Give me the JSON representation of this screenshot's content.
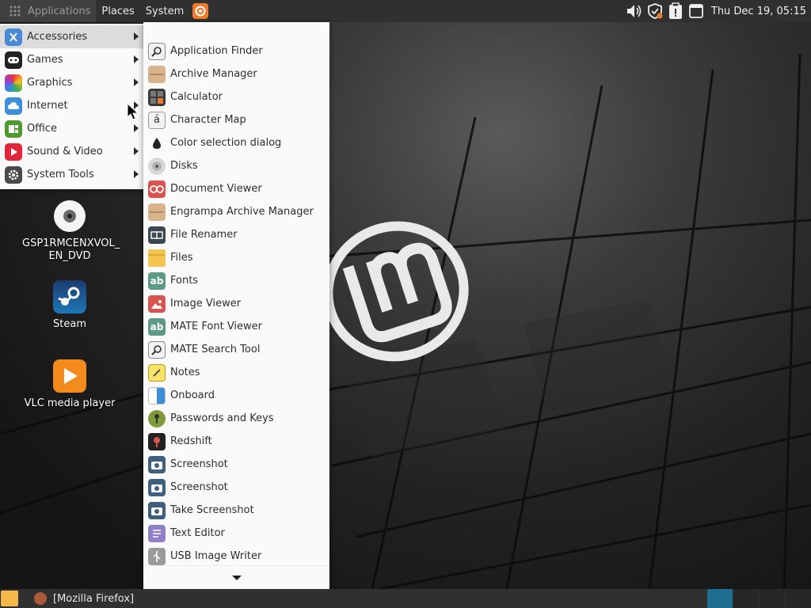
{
  "top_panel": {
    "menus": [
      "Applications",
      "Places",
      "System"
    ],
    "clock": "Thu Dec 19, 05:15",
    "tray_icons": [
      "volume-icon",
      "shield-update-icon",
      "clipboard-icon",
      "window-list-icon"
    ]
  },
  "categories": [
    {
      "label": "Accessories",
      "icon": "scissors-icon",
      "color": "#4a8ad4",
      "selected": true
    },
    {
      "label": "Games",
      "icon": "gamepad-icon",
      "color": "#222222"
    },
    {
      "label": "Graphics",
      "icon": "palette-icon",
      "color": "#d64bb0"
    },
    {
      "label": "Internet",
      "icon": "cloud-icon",
      "color": "#3c8fd8"
    },
    {
      "label": "Office",
      "icon": "office-icon",
      "color": "#4e9a2f"
    },
    {
      "label": "Sound & Video",
      "icon": "play-icon",
      "color": "#e0263a"
    },
    {
      "label": "System Tools",
      "icon": "gear-icon",
      "color": "#4a4a4a"
    }
  ],
  "submenu_items": [
    {
      "label": "Application Finder",
      "icon": "magnifier-icon"
    },
    {
      "label": "Archive Manager",
      "icon": "archive-icon"
    },
    {
      "label": "Calculator",
      "icon": "calculator-icon"
    },
    {
      "label": "Character Map",
      "icon": "character-map-icon"
    },
    {
      "label": "Color selection dialog",
      "icon": "color-drop-icon"
    },
    {
      "label": "Disks",
      "icon": "disk-icon"
    },
    {
      "label": "Document Viewer",
      "icon": "document-viewer-icon"
    },
    {
      "label": "Engrampa Archive Manager",
      "icon": "archive-icon"
    },
    {
      "label": "File Renamer",
      "icon": "file-renamer-icon"
    },
    {
      "label": "Files",
      "icon": "folder-icon"
    },
    {
      "label": "Fonts",
      "icon": "fonts-icon"
    },
    {
      "label": "Image Viewer",
      "icon": "image-viewer-icon"
    },
    {
      "label": "MATE Font Viewer",
      "icon": "fonts-icon"
    },
    {
      "label": "MATE Search Tool",
      "icon": "magnifier-icon"
    },
    {
      "label": "Notes",
      "icon": "notes-icon"
    },
    {
      "label": "Onboard",
      "icon": "onboard-icon"
    },
    {
      "label": "Passwords and Keys",
      "icon": "key-icon"
    },
    {
      "label": "Redshift",
      "icon": "redshift-icon"
    },
    {
      "label": "Screenshot",
      "icon": "camera-icon"
    },
    {
      "label": "Screenshot",
      "icon": "camera-icon"
    },
    {
      "label": "Take Screenshot",
      "icon": "camera-icon"
    },
    {
      "label": "Text Editor",
      "icon": "text-editor-icon"
    },
    {
      "label": "USB Image Writer",
      "icon": "usb-icon"
    }
  ],
  "desktop_icons": [
    {
      "label": "GSP1RMCENXVOL_\nEN_DVD",
      "line1": "GSP1RMCENXVOL_",
      "line2": "EN_DVD",
      "icon": "dvd-icon"
    },
    {
      "label": "Steam",
      "icon": "steam-icon"
    },
    {
      "label": "VLC media player",
      "icon": "vlc-icon"
    }
  ],
  "bottom_panel": {
    "task_label": "[Mozilla Firefox]"
  }
}
